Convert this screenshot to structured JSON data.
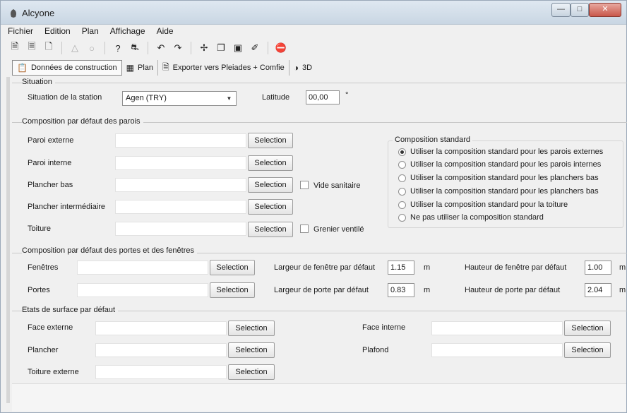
{
  "app": {
    "title": "Alcyone"
  },
  "menu": [
    "Fichier",
    "Edition",
    "Plan",
    "Affichage",
    "Aide"
  ],
  "tabs": [
    {
      "label": "Données de construction"
    },
    {
      "label": "Plan"
    },
    {
      "label": "Exporter vers Pleiades + Comfie"
    },
    {
      "label": "3D"
    }
  ],
  "situation": {
    "title": "Situation",
    "station_label": "Situation de la station",
    "station_value": "Agen (TRY)",
    "latitude_label": "Latitude",
    "latitude_value": "00,00",
    "latitude_unit": "°"
  },
  "parois": {
    "title": "Composition par défaut des parois",
    "rows": [
      {
        "label": "Paroi externe",
        "button": "Selection"
      },
      {
        "label": "Paroi interne",
        "button": "Selection"
      },
      {
        "label": "Plancher bas",
        "button": "Selection",
        "check": "Vide sanitaire"
      },
      {
        "label": "Plancher intermédiaire",
        "button": "Selection"
      },
      {
        "label": "Toiture",
        "button": "Selection",
        "check": "Grenier ventilé"
      }
    ],
    "standard": {
      "title": "Composition standard",
      "options": [
        "Utiliser la composition standard pour les parois externes",
        "Utiliser la composition standard pour les parois internes",
        "Utiliser la composition standard pour les planchers bas",
        "Utiliser la composition standard pour les planchers bas",
        "Utiliser la composition standard pour la toiture",
        "Ne pas utiliser la composition standard"
      ],
      "selected_index": 0
    }
  },
  "portes": {
    "title": "Composition par défaut des portes et des fenêtres",
    "fenetres_label": "Fenêtres",
    "portes_label": "Portes",
    "button": "Selection",
    "largeur_fenetre_label": "Largeur de fenêtre par défaut",
    "largeur_fenetre_value": "1.15",
    "largeur_porte_label": "Largeur de porte par défaut",
    "largeur_porte_value": "0.83",
    "hauteur_fenetre_label": "Hauteur de fenêtre par défaut",
    "hauteur_fenetre_value": "1.00",
    "hauteur_porte_label": "Hauteur de porte par défaut",
    "hauteur_porte_value": "2.04",
    "unit": "m"
  },
  "surface": {
    "title": "Etats de surface par défaut",
    "face_externe": "Face externe",
    "plancher": "Plancher",
    "toiture_externe": "Toiture externe",
    "face_interne": "Face interne",
    "plafond": "Plafond",
    "button": "Selection"
  }
}
